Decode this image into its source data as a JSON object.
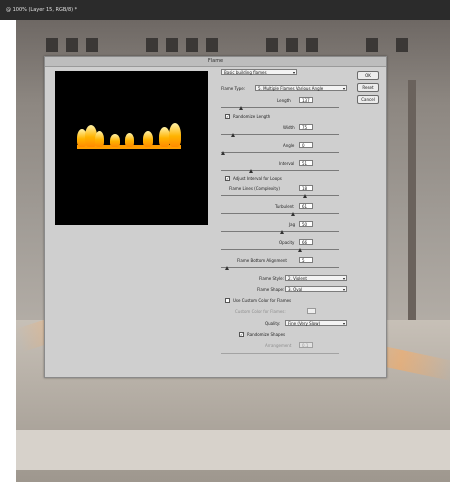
{
  "document_tab": {
    "title": "@ 100% (Layer 15, RGB/8) *"
  },
  "dialog": {
    "title": "Flame",
    "preset": {
      "value": "Basic building flames"
    },
    "flame_type": {
      "label": "Flame Type:",
      "value": "5. Multiple Flames Various Angle"
    },
    "params": [
      {
        "id": "length",
        "label": "Length",
        "value": "137",
        "position_pct": 18
      },
      {
        "id": "width",
        "label": "Width",
        "value": "75",
        "position_pct": 10
      },
      {
        "id": "angle",
        "label": "Angle",
        "value": "0",
        "position_pct": 0
      },
      {
        "id": "interval",
        "label": "Interval",
        "value": "51",
        "position_pct": 25
      }
    ],
    "randomize_length": {
      "label": "Randomize Length",
      "checked": true
    },
    "adjust_interval": {
      "label": "Adjust Interval for Loops",
      "checked": true
    },
    "params2": [
      {
        "id": "complexity",
        "label": "Flame Lines (Complexity)",
        "value": "18",
        "position_pct": 70
      },
      {
        "id": "turbulent",
        "label": "Turbulent",
        "value": "61",
        "position_pct": 60
      },
      {
        "id": "jag",
        "label": "Jag",
        "value": "50",
        "position_pct": 50
      },
      {
        "id": "opacity",
        "label": "Opacity",
        "value": "66",
        "position_pct": 66
      },
      {
        "id": "bottom_alignment",
        "label": "Flame Bottom Alignment",
        "value": "5",
        "position_pct": 5
      }
    ],
    "flame_style": {
      "label": "Flame Style:",
      "value": "2. Violent"
    },
    "flame_shape": {
      "label": "Flame Shape:",
      "value": "3. Oval"
    },
    "custom_color": {
      "label": "Use Custom Color for Flames",
      "checked": false
    },
    "custom_color_field": {
      "label": "Custom Color for Flames:"
    },
    "quality": {
      "label": "Quality:",
      "value": "Fine (Very Slow)"
    },
    "randomize_shapes": {
      "label": "Randomize Shapes",
      "checked": true
    },
    "arrangement": {
      "label": "Arrangement",
      "value": "0.1"
    },
    "buttons": {
      "ok": "OK",
      "reset": "Reset",
      "cancel": "Cancel"
    }
  },
  "colors": {
    "dialog_bg": "#cfcfcf",
    "preview_bg": "#000000",
    "flame": "#ffb300"
  }
}
